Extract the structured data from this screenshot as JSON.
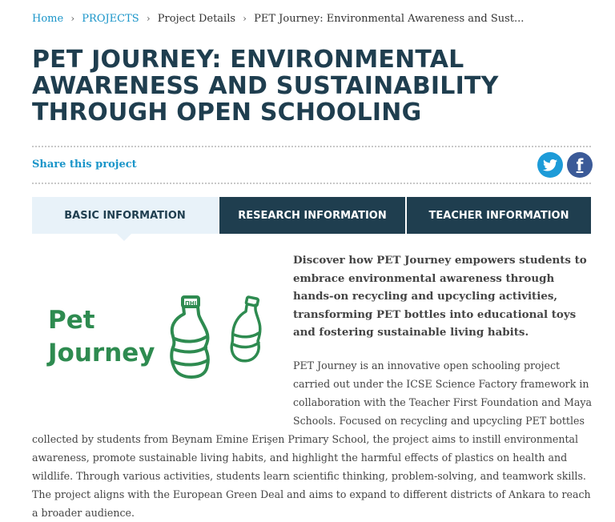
{
  "breadcrumb": {
    "home": "Home",
    "projects": "PROJECTS",
    "details": "Project Details",
    "current": "PET Journey: Environmental Awareness and Sust...",
    "separator": "›"
  },
  "page": {
    "title": "PET JOURNEY: ENVIRONMENTAL AWARENESS AND SUSTAINABILITY THROUGH OPEN SCHOOLING"
  },
  "share": {
    "label": "Share this project",
    "icons": [
      "twitter-icon",
      "facebook-icon"
    ],
    "facebook_glyph": "f"
  },
  "tabs": [
    {
      "label": "BASIC INFORMATION",
      "active": true
    },
    {
      "label": "RESEARCH INFORMATION",
      "active": false
    },
    {
      "label": "TEACHER INFORMATION",
      "active": false
    }
  ],
  "logo": {
    "line1": "Pet",
    "line2": "Journey",
    "bottle_cap_text": "ΠHI",
    "color": "#2e8b50"
  },
  "content": {
    "lead": "Discover how PET Journey empowers students to embrace environmental awareness through hands-on recycling and upcycling activities, transforming PET bottles into educational toys and fostering sustainable living habits.",
    "body": "PET Journey is an innovative open schooling project carried out under the ICSE Science Factory framework in collaboration with the Teacher First Foundation and Maya Schools. Focused on recycling and upcycling PET bottles collected by students from Beynam Emine Erişen Primary School, the project aims to instill environmental awareness, promote sustainable living habits, and highlight the harmful effects of plastics on health and wildlife. Through various activities, students learn scientific thinking, problem-solving, and teamwork skills. The project aligns with the European Green Deal and aims to expand to different districts of Ankara to reach a broader audience."
  },
  "colors": {
    "navy": "#1f3e4f",
    "link": "#1a95c9",
    "tab_active_bg": "#e8f2f9",
    "twitter": "#1d9bd8",
    "facebook": "#3b5a98"
  }
}
